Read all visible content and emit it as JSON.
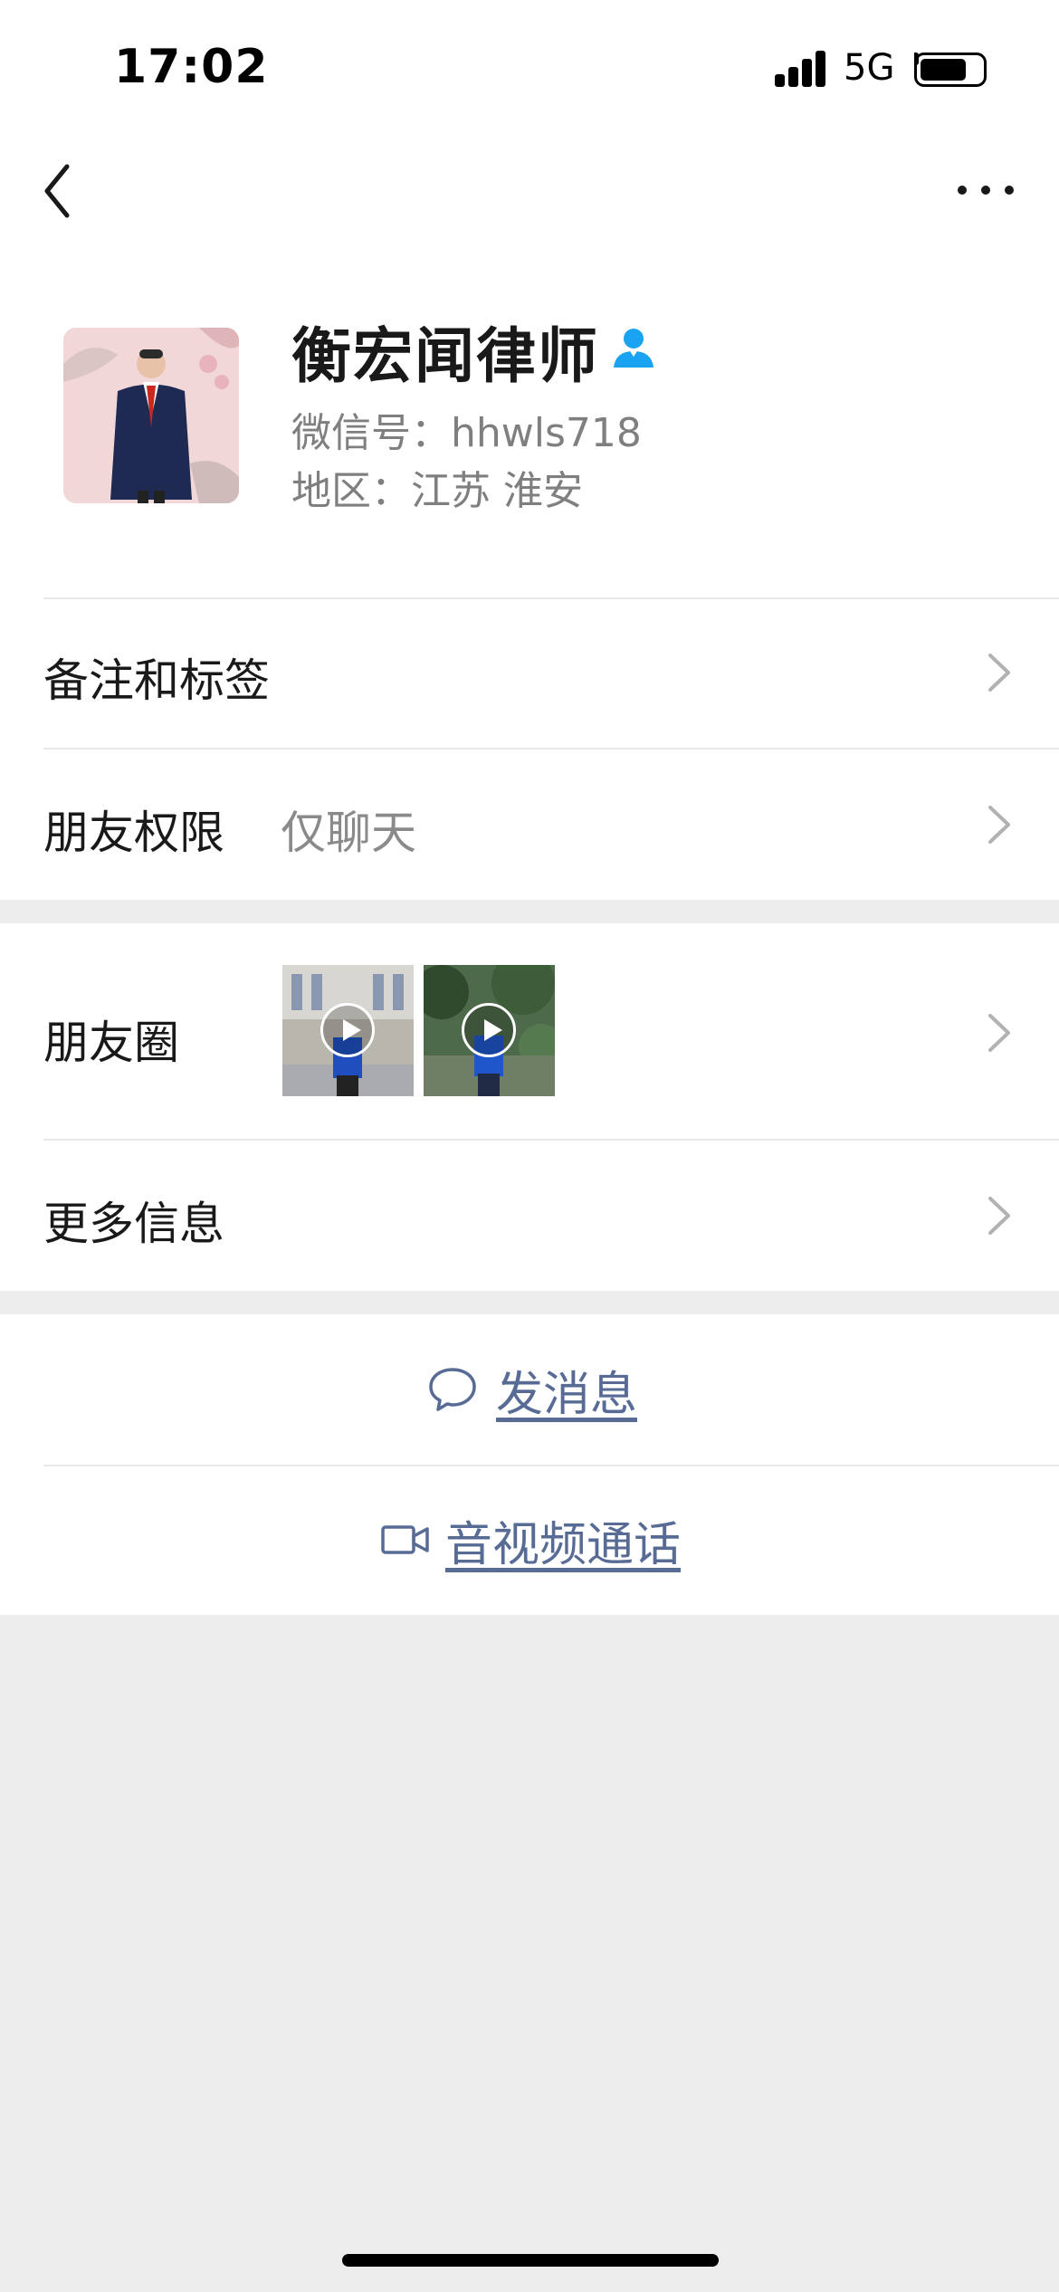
{
  "status_bar": {
    "time": "17:02",
    "network": "5G"
  },
  "profile": {
    "name": "衡宏闻律师",
    "wechat_id": "微信号：hhwls718",
    "region": "地区：江苏 淮安",
    "verified_icon": "person-verified-icon"
  },
  "rows": {
    "remark": {
      "label": "备注和标签"
    },
    "permission": {
      "label": "朋友权限",
      "value": "仅聊天"
    },
    "moments": {
      "label": "朋友圈"
    },
    "more_info": {
      "label": "更多信息"
    }
  },
  "actions": {
    "message": {
      "label": "发消息",
      "icon": "chat-bubble-icon"
    },
    "call": {
      "label": "音视频通话",
      "icon": "video-camera-icon"
    }
  },
  "colors": {
    "link": "#576b95",
    "background": "#ededed",
    "accent": "#1aa3f0"
  }
}
